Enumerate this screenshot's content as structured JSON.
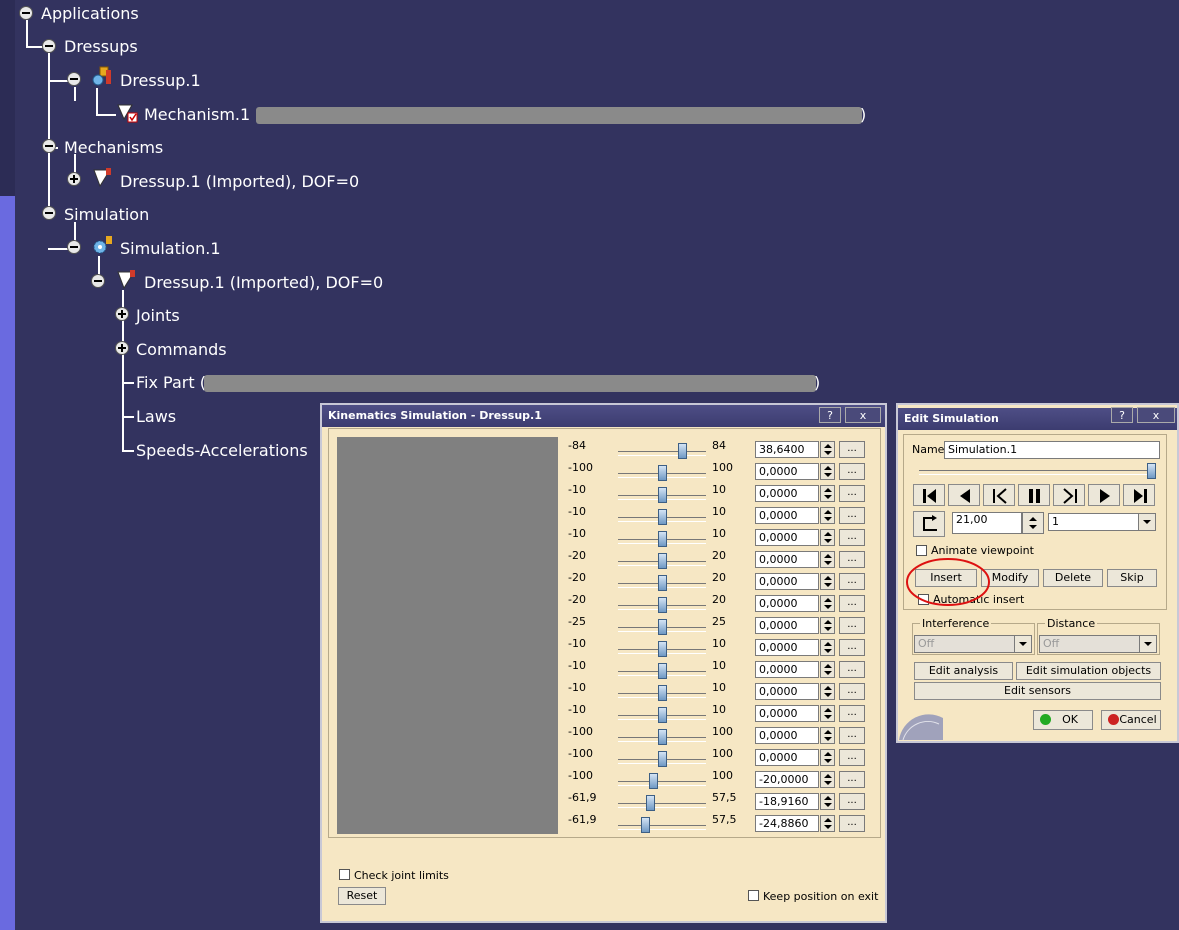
{
  "tree": {
    "applications": "Applications",
    "dressups": "Dressups",
    "dressup1": "Dressup.1",
    "mechanism1_prefix": "Mechanism.1 (",
    "mechanism1_suffix": ")",
    "mechanisms": "Mechanisms",
    "dressup_imported": "Dressup.1 (Imported), DOF=0",
    "simulation": "Simulation",
    "simulation1": "Simulation.1",
    "sim_dressup": "Dressup.1 (Imported), DOF=0",
    "joints": "Joints",
    "commands": "Commands",
    "fixpart_prefix": "Fix Part (",
    "fixpart_suffix": ")",
    "laws": "Laws",
    "speeds": "Speeds-Accelerations"
  },
  "kin": {
    "title": "Kinematics Simulation - Dressup.1",
    "help": "?",
    "close": "x",
    "rows": [
      {
        "min": "-84",
        "max": "84",
        "value": "38,6400",
        "pos": 0.73
      },
      {
        "min": "-100",
        "max": "100",
        "value": "0,0000",
        "pos": 0.5
      },
      {
        "min": "-10",
        "max": "10",
        "value": "0,0000",
        "pos": 0.5
      },
      {
        "min": "-10",
        "max": "10",
        "value": "0,0000",
        "pos": 0.5
      },
      {
        "min": "-10",
        "max": "10",
        "value": "0,0000",
        "pos": 0.5
      },
      {
        "min": "-20",
        "max": "20",
        "value": "0,0000",
        "pos": 0.5
      },
      {
        "min": "-20",
        "max": "20",
        "value": "0,0000",
        "pos": 0.5
      },
      {
        "min": "-20",
        "max": "20",
        "value": "0,0000",
        "pos": 0.5
      },
      {
        "min": "-25",
        "max": "25",
        "value": "0,0000",
        "pos": 0.5
      },
      {
        "min": "-10",
        "max": "10",
        "value": "0,0000",
        "pos": 0.5
      },
      {
        "min": "-10",
        "max": "10",
        "value": "0,0000",
        "pos": 0.5
      },
      {
        "min": "-10",
        "max": "10",
        "value": "0,0000",
        "pos": 0.5
      },
      {
        "min": "-10",
        "max": "10",
        "value": "0,0000",
        "pos": 0.5
      },
      {
        "min": "-100",
        "max": "100",
        "value": "0,0000",
        "pos": 0.5
      },
      {
        "min": "-100",
        "max": "100",
        "value": "0,0000",
        "pos": 0.5
      },
      {
        "min": "-100",
        "max": "100",
        "value": "-20,0000",
        "pos": 0.4
      },
      {
        "min": "-61,9",
        "max": "57,5",
        "value": "-18,9160",
        "pos": 0.36
      },
      {
        "min": "-61,9",
        "max": "57,5",
        "value": "-24,8860",
        "pos": 0.31
      }
    ],
    "dots": "...",
    "check_joint_limits": "Check joint limits",
    "reset": "Reset",
    "keep_position": "Keep position on exit"
  },
  "edit": {
    "title": "Edit Simulation",
    "help": "?",
    "close": "x",
    "name_label": "Name:",
    "name_value": "Simulation.1",
    "slider_pos": 0.99,
    "step_value": "21,00",
    "speed_value": "1",
    "animate_viewpoint": "Animate viewpoint",
    "insert": "Insert",
    "modify": "Modify",
    "delete": "Delete",
    "skip": "Skip",
    "automatic_insert": "Automatic insert",
    "interference_label": "Interference",
    "interference_value": "Off",
    "distance_label": "Distance",
    "distance_value": "Off",
    "edit_analysis": "Edit analysis",
    "edit_sim_objects": "Edit simulation objects",
    "edit_sensors": "Edit sensors",
    "ok": "OK",
    "cancel": "Cancel",
    "colors": {
      "ok": "#22aa22",
      "cancel": "#cc2222",
      "highlight": "#dd1111"
    }
  }
}
